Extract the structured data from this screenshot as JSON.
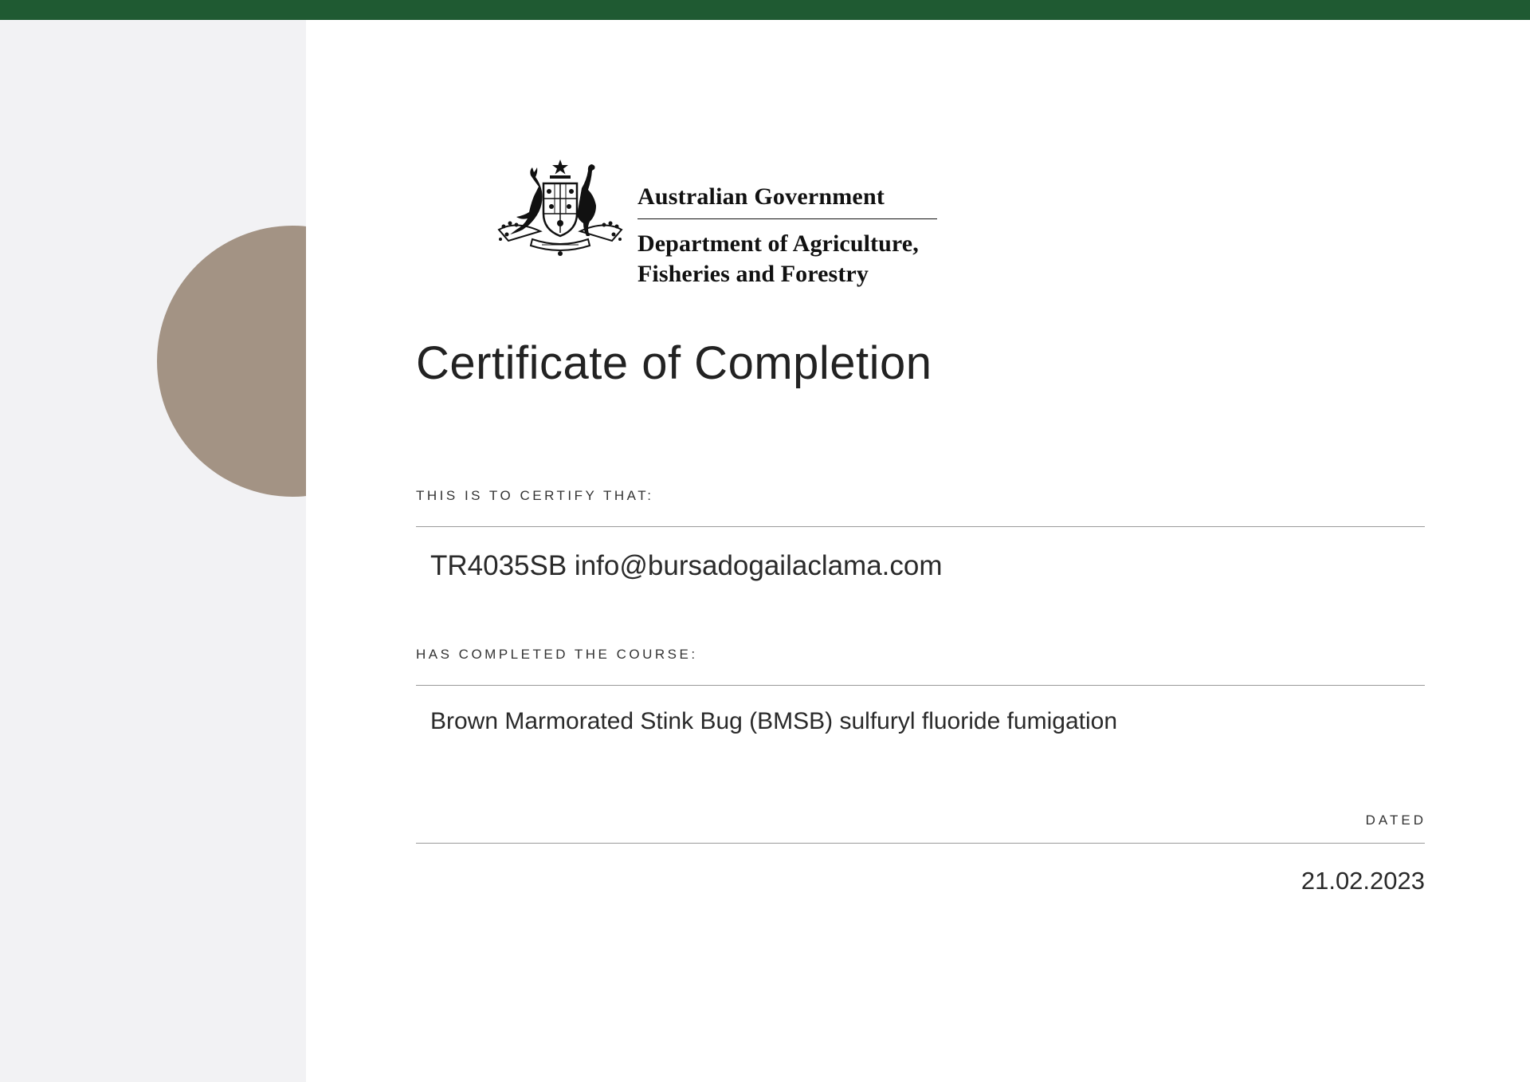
{
  "colors": {
    "top_bar": "#1f5a32",
    "left_panel": "#f2f2f4",
    "circle": "#a39384"
  },
  "logo": {
    "crest_icon": "australian-coat-of-arms-icon",
    "government": "Australian Government",
    "department_line1": "Department of Agriculture,",
    "department_line2": "Fisheries and Forestry"
  },
  "certificate": {
    "title": "Certificate of Completion",
    "certify_label": "THIS IS TO CERTIFY THAT:",
    "recipient": "TR4035SB info@bursadogailaclama.com",
    "course_label": "HAS COMPLETED THE COURSE:",
    "course": "Brown Marmorated Stink Bug (BMSB) sulfuryl fluoride fumigation",
    "dated_label": "DATED",
    "date": "21.02.2023"
  }
}
